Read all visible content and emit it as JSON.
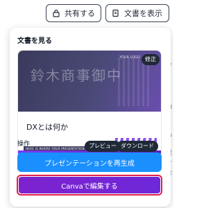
{
  "topbar": {
    "share_label": "共有する",
    "view_doc_label": "文書を表示"
  },
  "panel": {
    "title": "文書を見る",
    "doc_card": {
      "thumbnail_text": "鈴木商事御中",
      "logo_text": "YOUR LOGO",
      "edit_badge": "修正",
      "doc_title": "DXとは何か",
      "tagline": "HERE IS WHERE YOUR PRESENTATION BEGINS",
      "preview_label": "プレビュー",
      "download_label": "ダウンロード"
    },
    "actions_label": "操作",
    "regenerate_label": "プレゼンテーションを再生成",
    "canva_edit_label": "Canvaで編集する"
  },
  "background": {
    "fragments": [
      "F",
      "al",
      "ts",
      "提",
      "す",
      "ポ"
    ]
  },
  "colors": {
    "blue_button": "#1a90ff",
    "purple_button": "#7e22ce",
    "highlight_border": "#e11d48"
  }
}
